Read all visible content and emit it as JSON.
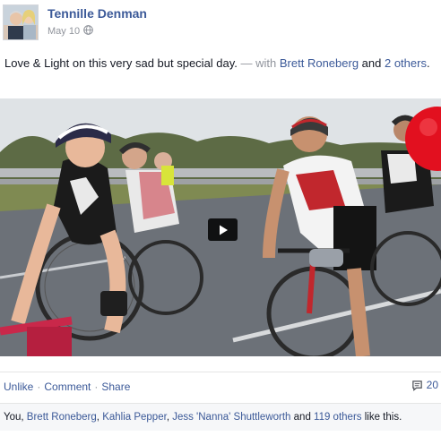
{
  "post": {
    "author": "Tennille Denman",
    "date": "May 10",
    "privacy_icon": "globe-icon",
    "message": {
      "text": "Love & Light on this very sad but special day.",
      "with_prefix": " — with ",
      "tagged_person": "Brett Roneberg",
      "and_word": " and ",
      "others_link": "2 others",
      "end": "."
    },
    "video": {
      "play_icon": "play-icon"
    },
    "actions": {
      "unlike": "Unlike",
      "comment": "Comment",
      "share": "Share",
      "separator": "·"
    },
    "comment_count": "20",
    "comment_icon": "comment-icon",
    "likes": {
      "prefix": "You, ",
      "person1": "Brett Roneberg",
      "comma1": ", ",
      "person2": "Kahlia Pepper",
      "comma2": ", ",
      "person3": "Jess 'Nanna' Shuttleworth",
      "and_word": " and ",
      "others_link": "119 others",
      "suffix": " like this."
    }
  },
  "colors": {
    "link": "#3b5998",
    "meta": "#90949c",
    "text": "#141823"
  }
}
